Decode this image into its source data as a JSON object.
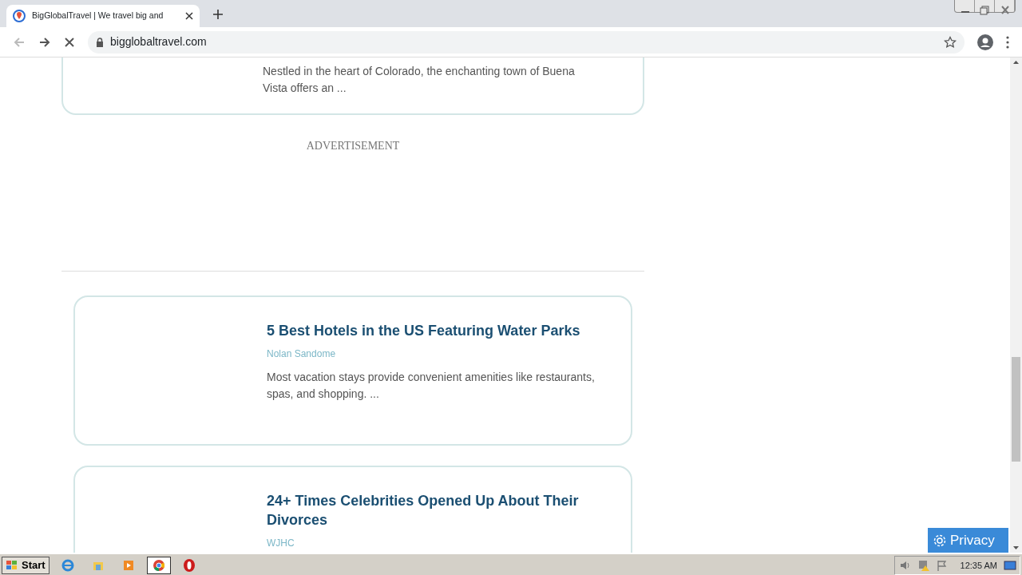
{
  "browser": {
    "tab_title": "BigGlobalTravel | We travel big and",
    "url": "bigglobaltravel.com"
  },
  "page": {
    "partial_card": {
      "excerpt": "Nestled in the heart of Colorado, the enchanting town of Buena Vista offers an ..."
    },
    "advertisement": "ADVERTISEMENT",
    "articles": [
      {
        "title": "5 Best Hotels in the US Featuring Water Parks",
        "author": "Nolan Sandome",
        "excerpt": "Most vacation stays provide convenient amenities like restaurants, spas, and shopping. ..."
      },
      {
        "title": "24+ Times Celebrities Opened Up About Their Divorces",
        "author": "WJHC"
      }
    ],
    "privacy_button": "Privacy"
  },
  "taskbar": {
    "start": "Start",
    "apps": [
      {
        "kind": "ie",
        "selected": false
      },
      {
        "kind": "folder",
        "selected": false
      },
      {
        "kind": "media",
        "selected": false
      },
      {
        "kind": "chrome",
        "selected": true
      },
      {
        "kind": "opera",
        "selected": false
      }
    ],
    "clock": "12:35 AM"
  }
}
